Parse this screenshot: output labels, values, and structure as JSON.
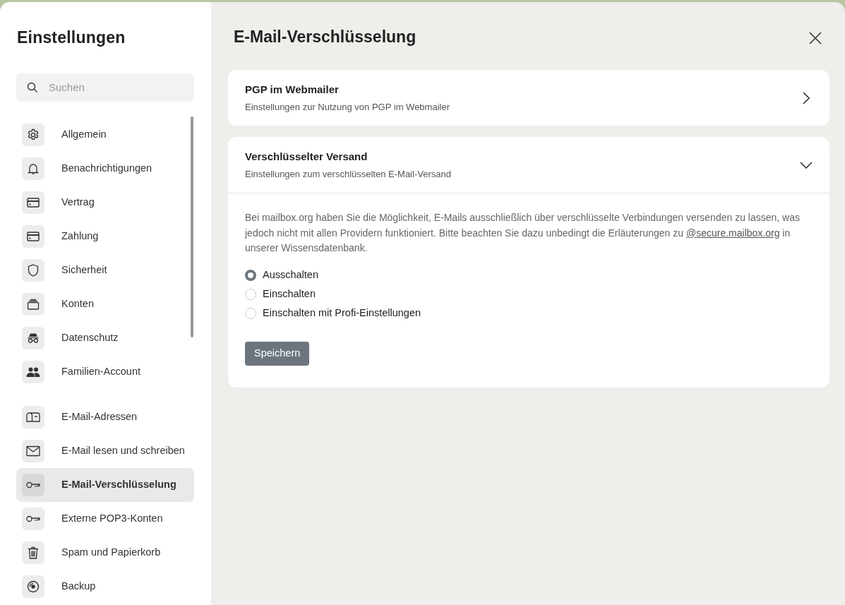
{
  "sidebar": {
    "title": "Einstellungen",
    "search": {
      "placeholder": "Suchen"
    },
    "groups": [
      {
        "items": [
          {
            "label": "Allgemein",
            "selected": false
          },
          {
            "label": "Benachrichtigungen",
            "selected": false
          },
          {
            "label": "Vertrag",
            "selected": false
          },
          {
            "label": "Zahlung",
            "selected": false
          },
          {
            "label": "Sicherheit",
            "selected": false
          },
          {
            "label": "Konten",
            "selected": false
          },
          {
            "label": "Datenschutz",
            "selected": false
          },
          {
            "label": "Familien-Account",
            "selected": false
          }
        ]
      },
      {
        "items": [
          {
            "label": "E-Mail-Adressen",
            "selected": false
          },
          {
            "label": "E-Mail lesen und schreiben",
            "selected": false
          },
          {
            "label": "E-Mail-Verschlüsselung",
            "selected": true
          },
          {
            "label": "Externe POP3-Konten",
            "selected": false
          },
          {
            "label": "Spam und Papierkorb",
            "selected": false
          },
          {
            "label": "Backup",
            "selected": false
          }
        ]
      }
    ]
  },
  "main": {
    "title": "E-Mail-Verschlüsselung",
    "sections": [
      {
        "title": "PGP im Webmailer",
        "subtitle": "Einstellungen zur Nutzung von PGP im Webmailer",
        "expanded": false
      },
      {
        "title": "Verschlüsselter Versand",
        "subtitle": "Einstellungen zum verschlüsselten E-Mail-Versand",
        "expanded": true,
        "text_before": "Bei mailbox.org haben Sie die Möglichkeit, E-Mails ausschließlich über verschlüsselte Verbindungen versenden zu lassen, was jedoch nicht mit allen Providern funktioniert. Bitte beachten Sie dazu unbedingt die Erläuterungen zu",
        "link": "@secure.mailbox.org",
        "text_after": "in unserer Wissensdatenbank.",
        "options": [
          {
            "label": "Ausschalten",
            "selected": true
          },
          {
            "label": "Einschalten",
            "selected": false
          },
          {
            "label": "Einschalten mit Profi-Einstellungen",
            "selected": false
          }
        ],
        "button": "Speichern"
      }
    ]
  }
}
